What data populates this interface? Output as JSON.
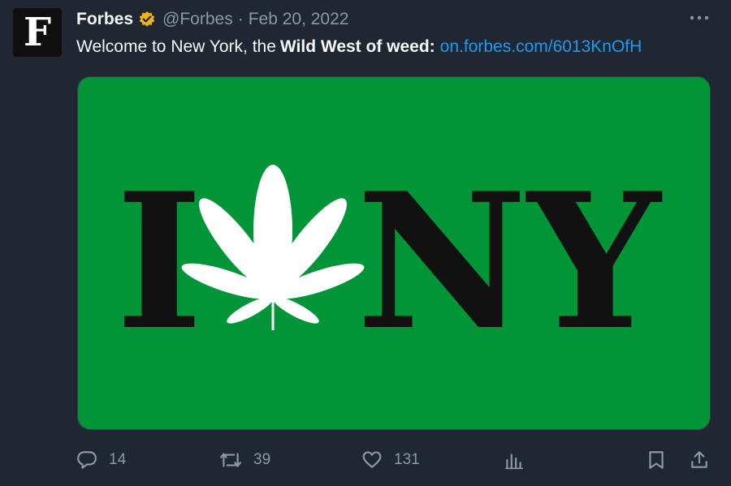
{
  "author": {
    "avatar_letter": "F",
    "name": "Forbes",
    "verified_badge": "gold-verified-badge",
    "handle": "@Forbes",
    "separator": "·",
    "date": "Feb 20, 2022"
  },
  "tweet": {
    "text_before": "Welcome to New York, the",
    "text_bold": "Wild West of weed:",
    "link": "on.forbes.com/6013KnOfH"
  },
  "media": {
    "letter_left": "I",
    "letters_right": "NY",
    "icon": "cannabis-leaf-icon",
    "background": "#029538"
  },
  "actions": {
    "replies": "14",
    "retweets": "39",
    "likes": "131"
  },
  "colors": {
    "background": "#1e2732",
    "text": "#f7f9f9",
    "muted": "#8b98a5",
    "link": "#1d9bf0",
    "badge": "#f4b31a"
  }
}
